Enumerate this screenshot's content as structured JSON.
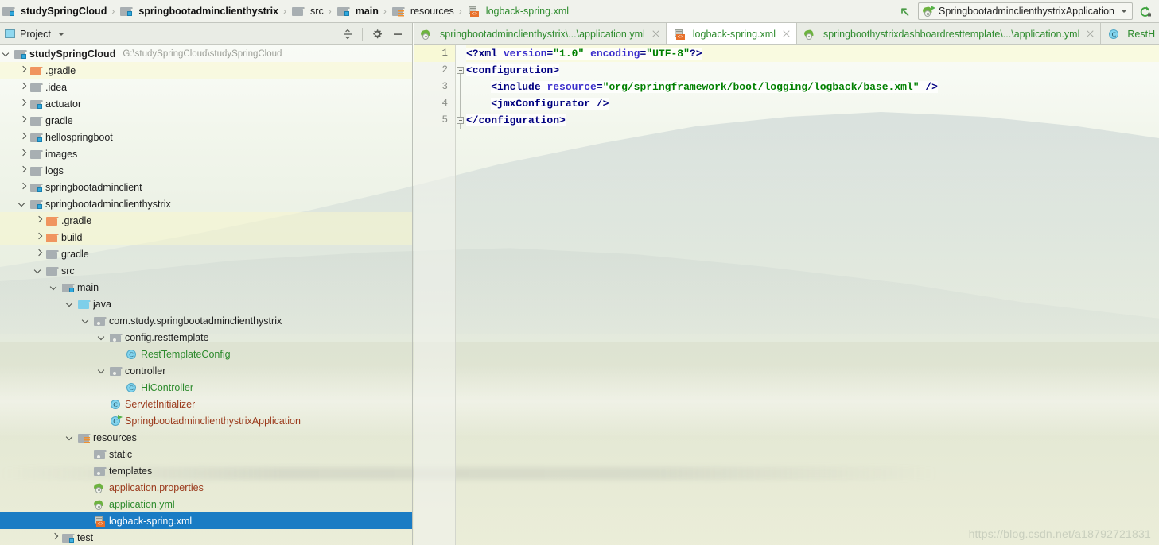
{
  "navbar": {
    "breadcrumbs": [
      {
        "label": "studySpringCloud",
        "icon": "module-folder-icon",
        "style": "bold"
      },
      {
        "label": "springbootadminclienthystrix",
        "icon": "module-folder-icon",
        "style": "bold"
      },
      {
        "label": "src",
        "icon": "folder-icon",
        "style": "plain"
      },
      {
        "label": "main",
        "icon": "source-folder-icon",
        "style": "bold"
      },
      {
        "label": "resources",
        "icon": "resources-folder-icon",
        "style": "plain"
      },
      {
        "label": "logback-spring.xml",
        "icon": "xml-file-icon",
        "style": "green"
      }
    ],
    "separator": "›",
    "back_arrow_icon": "arrow-up-left-icon",
    "run_configuration": "SpringbootadminclienthystrixApplication",
    "run_configuration_icon": "spring-boot-run-icon",
    "rerun_icon": "rerun-icon"
  },
  "project_panel": {
    "title": "Project",
    "title_icon": "project-view-icon",
    "dropdown_icon": "chevron-down-icon",
    "collapse_all_icon": "collapse-all-icon",
    "settings_icon": "gear-icon",
    "hide_icon": "minimize-icon",
    "tree": [
      {
        "label": "studySpringCloud",
        "path": "G:\\studySpringCloud\\studySpringCloud",
        "depth": 0,
        "arrow": "down",
        "icon": "module-folder-icon",
        "color": "dark",
        "bold": true,
        "state": "normal"
      },
      {
        "label": ".gradle",
        "depth": 1,
        "arrow": "right",
        "icon": "excluded-folder-icon",
        "color": "dark",
        "state": "highlight"
      },
      {
        "label": ".idea",
        "depth": 1,
        "arrow": "right",
        "icon": "folder-icon",
        "color": "dark",
        "state": "normal"
      },
      {
        "label": "actuator",
        "depth": 1,
        "arrow": "right",
        "icon": "module-folder-icon",
        "color": "dark",
        "state": "normal"
      },
      {
        "label": "gradle",
        "depth": 1,
        "arrow": "right",
        "icon": "folder-icon",
        "color": "dark",
        "state": "normal"
      },
      {
        "label": "hellospringboot",
        "depth": 1,
        "arrow": "right",
        "icon": "module-folder-icon",
        "color": "dark",
        "state": "normal"
      },
      {
        "label": "images",
        "depth": 1,
        "arrow": "right",
        "icon": "folder-icon",
        "color": "dark",
        "state": "normal"
      },
      {
        "label": "logs",
        "depth": 1,
        "arrow": "right",
        "icon": "folder-icon",
        "color": "dark",
        "state": "normal"
      },
      {
        "label": "springbootadminclient",
        "depth": 1,
        "arrow": "right",
        "icon": "module-folder-icon",
        "color": "dark",
        "state": "normal"
      },
      {
        "label": "springbootadminclienthystrix",
        "depth": 1,
        "arrow": "down",
        "icon": "module-folder-icon",
        "color": "dark",
        "state": "normal"
      },
      {
        "label": ".gradle",
        "depth": 2,
        "arrow": "right",
        "icon": "excluded-folder-icon",
        "color": "dark",
        "state": "highlight"
      },
      {
        "label": "build",
        "depth": 2,
        "arrow": "right",
        "icon": "excluded-folder-icon",
        "color": "dark",
        "state": "highlight"
      },
      {
        "label": "gradle",
        "depth": 2,
        "arrow": "right",
        "icon": "folder-icon",
        "color": "dark",
        "state": "normal"
      },
      {
        "label": "src",
        "depth": 2,
        "arrow": "down",
        "icon": "folder-icon",
        "color": "dark",
        "state": "normal"
      },
      {
        "label": "main",
        "depth": 3,
        "arrow": "down",
        "icon": "source-folder-icon",
        "color": "dark",
        "state": "normal"
      },
      {
        "label": "java",
        "depth": 4,
        "arrow": "down",
        "icon": "sources-root-icon",
        "color": "dark",
        "state": "normal"
      },
      {
        "label": "com.study.springbootadminclienthystrix",
        "depth": 5,
        "arrow": "down",
        "icon": "package-icon",
        "color": "dark",
        "state": "normal"
      },
      {
        "label": "config.resttemplate",
        "depth": 6,
        "arrow": "down",
        "icon": "package-icon",
        "color": "dark",
        "state": "normal"
      },
      {
        "label": "RestTemplateConfig",
        "depth": 7,
        "arrow": "none",
        "icon": "java-class-icon",
        "color": "green",
        "state": "normal"
      },
      {
        "label": "controller",
        "depth": 6,
        "arrow": "down",
        "icon": "package-icon",
        "color": "dark",
        "state": "normal"
      },
      {
        "label": "HiController",
        "depth": 7,
        "arrow": "none",
        "icon": "java-class-icon",
        "color": "green",
        "state": "normal"
      },
      {
        "label": "ServletInitializer",
        "depth": 6,
        "arrow": "none",
        "icon": "java-class-icon",
        "color": "brown",
        "state": "normal"
      },
      {
        "label": "SpringbootadminclienthystrixApplication",
        "depth": 6,
        "arrow": "none",
        "icon": "spring-boot-class-icon",
        "color": "brown",
        "state": "normal"
      },
      {
        "label": "resources",
        "depth": 4,
        "arrow": "down",
        "icon": "resources-folder-icon",
        "color": "dark",
        "state": "normal"
      },
      {
        "label": "static",
        "depth": 5,
        "arrow": "none",
        "icon": "package-icon",
        "color": "dark",
        "state": "normal"
      },
      {
        "label": "templates",
        "depth": 5,
        "arrow": "none",
        "icon": "package-icon",
        "color": "dark",
        "state": "normal"
      },
      {
        "label": "application.properties",
        "depth": 5,
        "arrow": "none",
        "icon": "spring-config-icon",
        "color": "brown",
        "state": "normal"
      },
      {
        "label": "application.yml",
        "depth": 5,
        "arrow": "none",
        "icon": "spring-config-icon",
        "color": "green",
        "state": "normal"
      },
      {
        "label": "logback-spring.xml",
        "depth": 5,
        "arrow": "none",
        "icon": "xml-file-icon",
        "color": "green",
        "state": "selected"
      },
      {
        "label": "test",
        "depth": 3,
        "arrow": "right",
        "icon": "test-folder-icon",
        "color": "dark",
        "state": "normal"
      }
    ]
  },
  "editor_tabs": [
    {
      "label": "springbootadminclienthystrix\\...\\application.yml",
      "icon": "spring-config-icon",
      "active": false,
      "close_icon": "close-icon"
    },
    {
      "label": "logback-spring.xml",
      "icon": "xml-file-icon",
      "active": true,
      "close_icon": "close-icon"
    },
    {
      "label": "springboothystrixdashboardresttemplate\\...\\application.yml",
      "icon": "spring-config-icon",
      "active": false,
      "close_icon": "close-icon"
    },
    {
      "label": "RestH",
      "icon": "java-class-icon",
      "active": false,
      "close_icon": "close-icon"
    }
  ],
  "editor": {
    "file": "logback-spring.xml",
    "current_line": 1,
    "lines": [
      {
        "number": "1",
        "tokens": [
          {
            "t": "<?xml ",
            "k": "tag"
          },
          {
            "t": "version",
            "k": "attr"
          },
          {
            "t": "=",
            "k": "plain"
          },
          {
            "t": "\"1.0\"",
            "k": "val"
          },
          {
            "t": " ",
            "k": "plain"
          },
          {
            "t": "encoding",
            "k": "attr"
          },
          {
            "t": "=",
            "k": "plain"
          },
          {
            "t": "\"UTF-8\"",
            "k": "val"
          },
          {
            "t": "?>",
            "k": "tag"
          }
        ],
        "indent": 0,
        "fold": "none"
      },
      {
        "number": "2",
        "tokens": [
          {
            "t": "<configuration>",
            "k": "tag"
          }
        ],
        "indent": 0,
        "fold": "open"
      },
      {
        "number": "3",
        "tokens": [
          {
            "t": "<include ",
            "k": "tag"
          },
          {
            "t": "resource",
            "k": "attr"
          },
          {
            "t": "=",
            "k": "plain"
          },
          {
            "t": "\"org/springframework/boot/logging/logback/base.xml\"",
            "k": "val"
          },
          {
            "t": " />",
            "k": "tag"
          }
        ],
        "indent": 4,
        "fold": "none"
      },
      {
        "number": "4",
        "tokens": [
          {
            "t": "<jmxConfigurator ",
            "k": "tag"
          },
          {
            "t": "/>",
            "k": "tag"
          }
        ],
        "indent": 4,
        "fold": "none"
      },
      {
        "number": "5",
        "tokens": [
          {
            "t": "</configuration>",
            "k": "tag"
          }
        ],
        "indent": 0,
        "fold": "close"
      }
    ]
  },
  "watermark": "https://blog.csdn.net/a18792721831",
  "colors": {
    "selection_blue": "#1a7cc4",
    "green_text": "#2e8b2e",
    "brown_text": "#9b3a1c",
    "xml_tag": "#000080",
    "xml_attr": "#3b2ecc",
    "xml_value": "#008000",
    "toolbar_bg": "#e9ece5",
    "spring_green": "#6db33f"
  }
}
